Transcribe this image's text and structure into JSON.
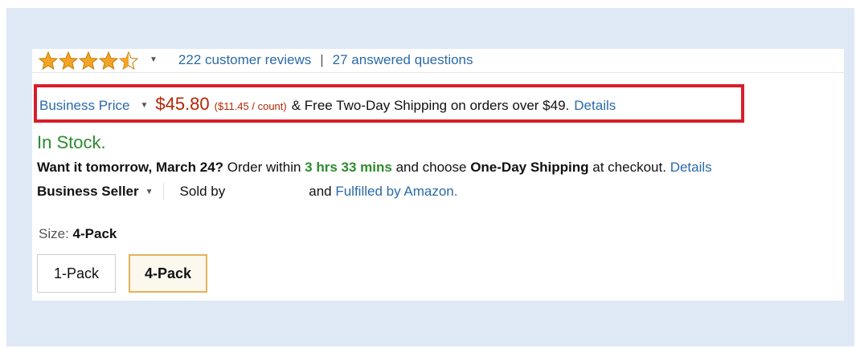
{
  "product": {
    "rating": {
      "stars": 4.5,
      "reviews_label": "222 customer reviews",
      "separator": "|",
      "questions_label": "27 answered questions"
    },
    "pricing": {
      "business_price_label": "Business Price",
      "price": "$45.80",
      "per_count": "($11.45 / count)",
      "shipping_text": "& Free Two-Day Shipping on orders over $49.",
      "details_label": "Details"
    },
    "availability": {
      "stock": "In Stock.",
      "delivery_lead": "Want it tomorrow, March 24?",
      "order_within": "Order within",
      "time_left": "3 hrs 33 mins",
      "choose": "and choose",
      "shipping_option": "One-Day Shipping",
      "at_checkout": "at checkout.",
      "details_label": "Details"
    },
    "seller": {
      "business_seller_label": "Business Seller",
      "sold_by": "Sold by",
      "fulfilled_prefix": "and",
      "fulfilled_link": "Fulfilled by Amazon."
    },
    "size": {
      "label": "Size:",
      "selected": "4-Pack",
      "options": [
        "1-Pack",
        "4-Pack"
      ]
    }
  },
  "colors": {
    "link": "#2a6aa8",
    "price": "#b12704",
    "in_stock": "#2e8b2e",
    "highlight_border": "#d81e2b",
    "selected_option_border": "#e2b35a"
  }
}
